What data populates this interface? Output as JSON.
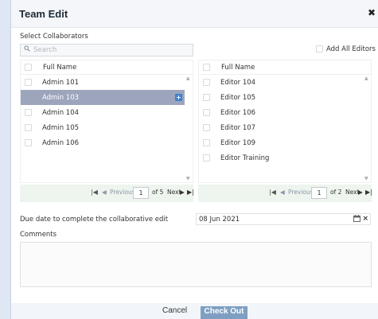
{
  "dialog": {
    "title": "Team Edit",
    "close_glyph": "✖"
  },
  "select_label": "Select Collaborators",
  "search": {
    "placeholder": "Search",
    "icon": "search-icon"
  },
  "add_all": {
    "label": "Add All Editors"
  },
  "left_list": {
    "header": "Full Name",
    "rows": [
      {
        "label": "Admin 101",
        "selected": false
      },
      {
        "label": "Admin 103",
        "selected": true
      },
      {
        "label": "Admin 104",
        "selected": false
      },
      {
        "label": "Admin 105",
        "selected": false
      },
      {
        "label": "Admin 106",
        "selected": false
      }
    ],
    "pager": {
      "previous": "Previous",
      "page": "1",
      "of": "of 5",
      "next": "Next"
    }
  },
  "right_list": {
    "header": "Full Name",
    "rows": [
      {
        "label": "Editor 104"
      },
      {
        "label": "Editor 105"
      },
      {
        "label": "Editor 106"
      },
      {
        "label": "Editor 107"
      },
      {
        "label": "Editor 109"
      },
      {
        "label": "Editor Training"
      }
    ],
    "pager": {
      "previous": "Previous",
      "page": "1",
      "of": "of 2",
      "next": "Next"
    }
  },
  "due": {
    "label": "Due date to complete the collaborative edit",
    "value": "08 Jun 2021"
  },
  "comments": {
    "label": "Comments",
    "value": ""
  },
  "footer": {
    "cancel": "Cancel",
    "checkout": "Check Out"
  },
  "colors": {
    "selected_row": "#9da5bd",
    "primary_button": "#7e9fc2",
    "pager_bg": "#eef4ee"
  }
}
